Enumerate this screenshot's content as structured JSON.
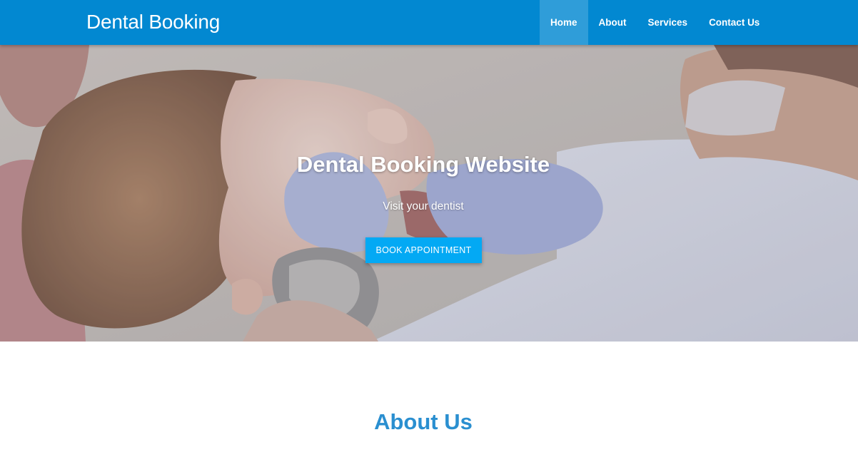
{
  "navbar": {
    "brand": "Dental Booking",
    "items": [
      {
        "label": "Home",
        "active": true
      },
      {
        "label": "About",
        "active": false
      },
      {
        "label": "Services",
        "active": false
      },
      {
        "label": "Contact Us",
        "active": false
      }
    ]
  },
  "hero": {
    "title": "Dental Booking Website",
    "subtitle": "Visit your dentist",
    "button_label": "BOOK APPOINTMENT"
  },
  "about": {
    "title": "About Us"
  },
  "colors": {
    "navbar": "#0288d1",
    "button": "#03a9f4",
    "heading": "#2a8fd0"
  }
}
